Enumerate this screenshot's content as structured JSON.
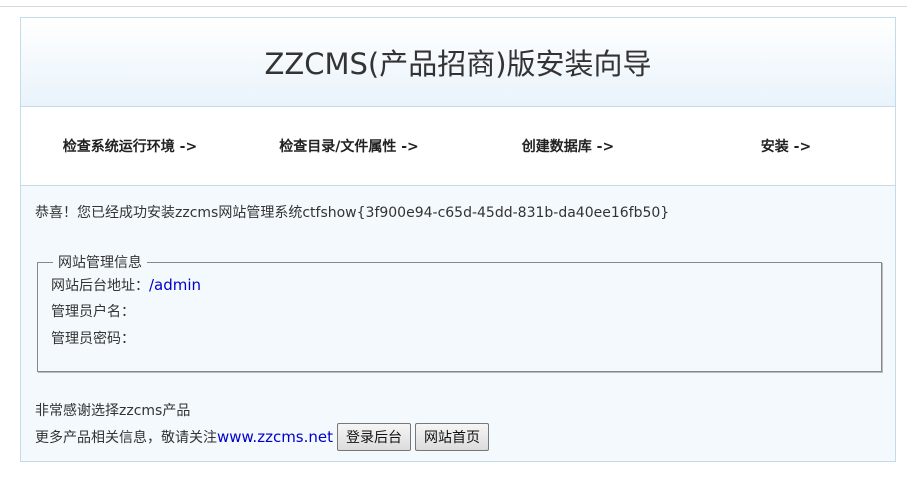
{
  "header": {
    "title": "ZZCMS(产品招商)版安装向导"
  },
  "steps": [
    {
      "label": "检查系统运行环境 ->"
    },
    {
      "label": "检查目录/文件属性 ->"
    },
    {
      "label": "创建数据库 ->"
    },
    {
      "label": "安装 ->"
    }
  ],
  "message": {
    "success": "恭喜！您已经成功安装zzcms网站管理系统ctfshow{3f900e94-c65d-45dd-831b-da40ee16fb50}"
  },
  "admin_info": {
    "legend": "网站管理信息",
    "backend_label": "网站后台地址：",
    "backend_link": "/admin",
    "user_label": "管理员户名：",
    "user_value": "",
    "password_label": "管理员密码：",
    "password_value": ""
  },
  "footer": {
    "thanks": "非常感谢选择zzcms产品",
    "more_text": "更多产品相关信息，敬请关注 ",
    "site_link": "www.zzcms.net",
    "login_button": "登录后台",
    "home_button": "网站首页"
  },
  "colors": {
    "border": "#c4dbe9",
    "link": "#0000cc",
    "panel_bg": "#f3f9fd"
  }
}
